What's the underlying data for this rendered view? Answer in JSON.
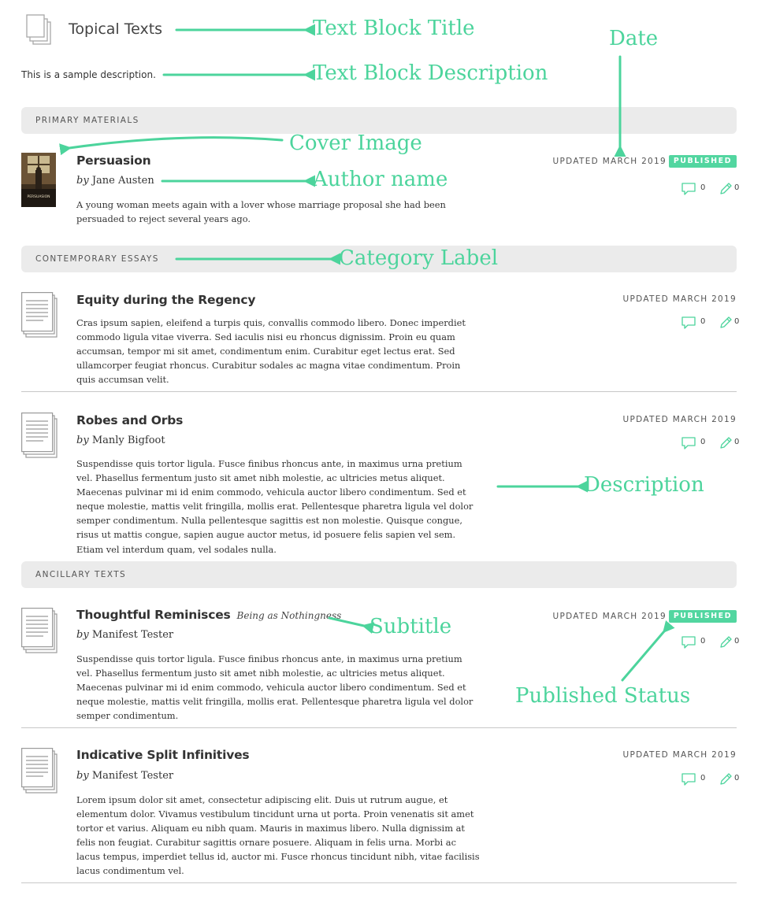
{
  "text_block": {
    "title": "Topical Texts",
    "description": "This is a sample description."
  },
  "categories": {
    "primary": "PRIMARY MATERIALS",
    "contemporary": "CONTEMPORARY ESSAYS",
    "ancillary": "ANCILLARY TEXTS"
  },
  "entries": [
    {
      "title": "Persuasion",
      "author_by": "by",
      "author": "Jane Austen",
      "description": "A young woman meets again with a lover whose marriage proposal she had been persuaded to reject several years ago.",
      "date": "UPDATED MARCH 2019",
      "status": "PUBLISHED",
      "comments": "0",
      "annotations": "0",
      "cover_title": "PERSUASION"
    },
    {
      "title": "Equity during the Regency",
      "description": "Cras ipsum sapien, eleifend a turpis quis, convallis commodo libero. Donec imperdiet com­modo ligula vitae viverra. Sed iaculis nisi eu rhoncus dignissim. Proin eu quam accumsan, tempor mi sit amet, condimentum enim. Curabitur eget lectus erat. Sed ullamcorper feugiat rhoncus. Curabitur sodales ac magna vitae condimentum. Proin quis accumsan velit.",
      "date": "UPDATED MARCH 2019",
      "comments": "0",
      "annotations": "0"
    },
    {
      "title": "Robes and Orbs",
      "author_by": "by",
      "author": "Manly Bigfoot",
      "description": "Suspendisse quis tortor ligula. Fusce finibus rhoncus ante, in maximus urna pretium vel. Phasellus fermentum justo sit amet nibh molestie, ac ultricies metus aliquet. Maecenas pulv­inar mi id enim commodo, vehicula auctor libero condimentum. Sed et neque molestie, mattis velit fringilla, mollis erat. Pellentesque pharetra ligula vel dolor semper condimentum. Nulla pellentesque sagittis est non molestie. Quisque congue, risus ut mattis congue, sapien augue auctor metus, id posuere felis sapien vel sem. Etiam vel interdum quam, vel sodales nulla.",
      "date": "UPDATED MARCH 2019",
      "comments": "0",
      "annotations": "0"
    },
    {
      "title": "Thoughtful Reminisces",
      "subtitle": "Being as Nothingness",
      "author_by": "by",
      "author": "Manifest Tester",
      "description": "Suspendisse quis tortor ligula. Fusce finibus rhoncus ante, in maximus urna pretium vel. Phasellus fermentum justo sit amet nibh molestie, ac ultricies metus aliquet. Maecenas pulv­inar mi id enim commodo, vehicula auctor libero condimentum. Sed et neque molestie, mattis velit fringilla, mollis erat. Pellentesque pharetra ligula vel dolor semper condimentum.",
      "date": "UPDATED MARCH 2019",
      "status": "PUBLISHED",
      "comments": "0",
      "annotations": "0"
    },
    {
      "title": "Indicative Split Infinitives",
      "author_by": "by",
      "author": "Manifest Tester",
      "description": "Lorem ipsum dolor sit amet, consectetur adipiscing elit. Duis ut rutrum augue, et elementum dolor. Vivamus vestibulum tincidunt urna ut porta. Proin venenatis sit amet tortor et varius. Aliquam eu nibh quam. Mauris in maximus libero. Nulla dignissim at felis non feugiat. Cur­abitur sagittis ornare posuere. Aliquam in felis urna. Morbi ac lacus tempus, imperdiet tellus id, auctor mi. Fusce rhoncus tincidunt nibh, vitae facilisis lacus condimentum vel.",
      "date": "UPDATED MARCH 2019",
      "comments": "0",
      "annotations": "0"
    }
  ],
  "annotations": {
    "text_block_title": "Text Block Title",
    "text_block_description": "Text Block Description",
    "date": "Date",
    "cover_image": "Cover Image",
    "author_name": "Author name",
    "category_label": "Category Label",
    "description": "Description",
    "subtitle": "Subtitle",
    "published_status": "Published Status"
  },
  "colors": {
    "accent": "#4cd49c",
    "badge": "#52d6a0",
    "category_bg": "#ebebeb",
    "icon_gray": "#9a9a9a"
  },
  "icons": {
    "block": "stacked-pages-icon",
    "text": "document-icon",
    "comments": "speech-bubble-icon",
    "annotations": "pencil-icon"
  }
}
